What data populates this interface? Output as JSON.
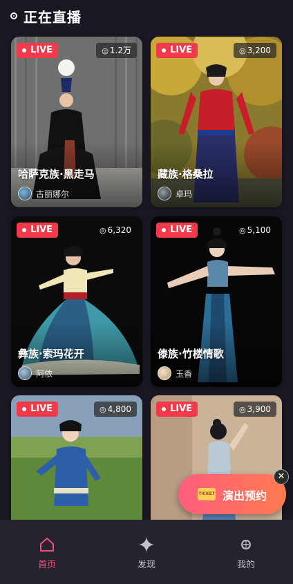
{
  "header": {
    "title": "正在直播"
  },
  "live_badge": "LIVE",
  "viewer_icon": "◎",
  "cards": [
    {
      "title": "哈萨克族·黑走马",
      "streamer": "古丽娜尔",
      "viewers": "1.2万"
    },
    {
      "title": "藏族·格桑拉",
      "streamer": "卓玛",
      "viewers": "3,200"
    },
    {
      "title": "彝族·索玛花开",
      "streamer": "阿依",
      "viewers": "6,320"
    },
    {
      "title": "傣族·竹楼情歌",
      "streamer": "玉香",
      "viewers": "5,100"
    },
    {
      "title": "",
      "streamer": "",
      "viewers": "4,800"
    },
    {
      "title": "",
      "streamer": "",
      "viewers": "3,900"
    }
  ],
  "promo": {
    "label": "演出预约",
    "ticket_text": "TICKET",
    "close": "✕"
  },
  "tabs": [
    {
      "label": "首页",
      "icon": "home-icon",
      "active": true
    },
    {
      "label": "发现",
      "icon": "sparkle-icon",
      "active": false
    },
    {
      "label": "我的",
      "icon": "profile-icon",
      "active": false
    }
  ],
  "colors": {
    "accent": "#f0507e",
    "live": "#f23a4a",
    "background": "#1a1722"
  }
}
